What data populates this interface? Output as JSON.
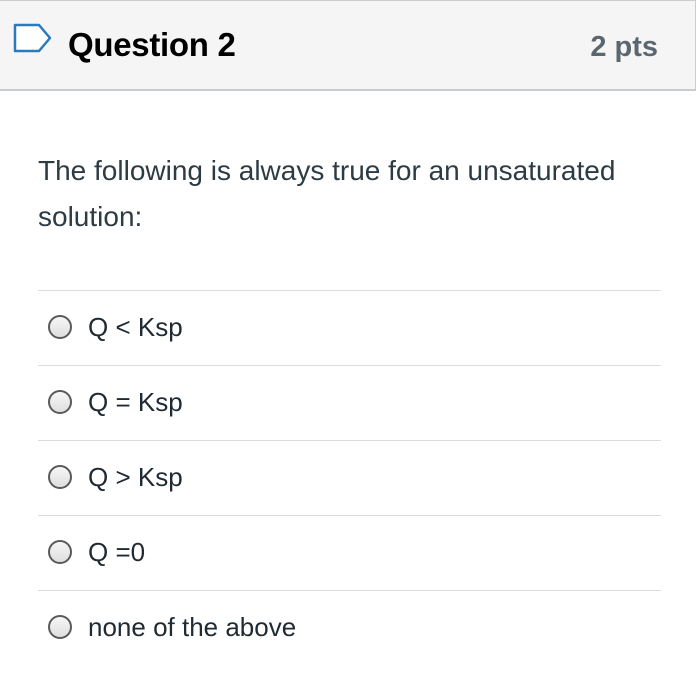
{
  "question": {
    "title": "Question 2",
    "points": "2 pts",
    "text": "The following is always true for an unsaturated solution:",
    "flag_icon": "flag-outline-icon"
  },
  "answers": [
    {
      "label": "Q < Ksp",
      "selected": false
    },
    {
      "label": "Q = Ksp",
      "selected": false
    },
    {
      "label": "Q > Ksp",
      "selected": false
    },
    {
      "label": "Q =0",
      "selected": false
    },
    {
      "label": "none of the above",
      "selected": false
    }
  ]
}
